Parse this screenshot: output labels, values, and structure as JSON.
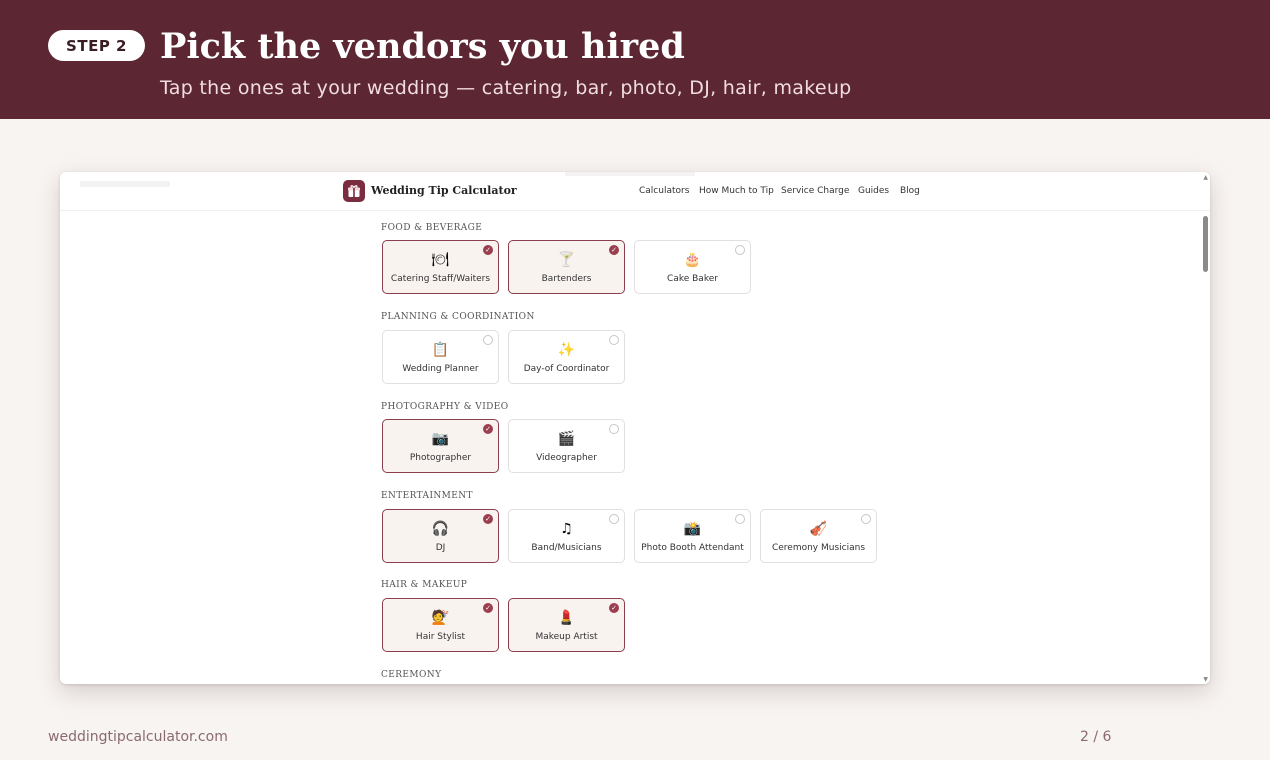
{
  "banner": {
    "step_label": "STEP 2",
    "title": "Pick the vendors you hired",
    "subtitle": "Tap the ones at your wedding — catering, bar, photo, DJ, hair, makeup",
    "background_color": "#5c2733"
  },
  "site": {
    "name": "Wedding Tip Calculator",
    "logo_icon": "gift-box-icon",
    "nav": [
      "Calculators",
      "How Much to Tip",
      "Service Charge",
      "Guides",
      "Blog"
    ],
    "accent_color": "#8b3e4d"
  },
  "sections": [
    {
      "heading": "FOOD & BEVERAGE",
      "vendors": [
        {
          "label": "Catering Staff/Waiters",
          "icon": "🍽",
          "icon_name": "plate-cutlery-icon",
          "selected": true
        },
        {
          "label": "Bartenders",
          "icon": "🍸",
          "icon_name": "cocktail-icon",
          "selected": true
        },
        {
          "label": "Cake Baker",
          "icon": "🎂",
          "icon_name": "cake-icon",
          "selected": false
        }
      ]
    },
    {
      "heading": "PLANNING & COORDINATION",
      "vendors": [
        {
          "label": "Wedding Planner",
          "icon": "📋",
          "icon_name": "clipboard-icon",
          "selected": false
        },
        {
          "label": "Day-of Coordinator",
          "icon": "✨",
          "icon_name": "sparkles-icon",
          "selected": false
        }
      ]
    },
    {
      "heading": "PHOTOGRAPHY & VIDEO",
      "vendors": [
        {
          "label": "Photographer",
          "icon": "📷",
          "icon_name": "camera-icon",
          "selected": true
        },
        {
          "label": "Videographer",
          "icon": "🎬",
          "icon_name": "clapperboard-icon",
          "selected": false
        }
      ]
    },
    {
      "heading": "ENTERTAINMENT",
      "vendors": [
        {
          "label": "DJ",
          "icon": "🎧",
          "icon_name": "headphones-icon",
          "selected": true
        },
        {
          "label": "Band/Musicians",
          "icon": "♫",
          "icon_name": "music-note-icon",
          "selected": false
        },
        {
          "label": "Photo Booth Attendant",
          "icon": "📸",
          "icon_name": "photo-booth-icon",
          "selected": false
        },
        {
          "label": "Ceremony Musicians",
          "icon": "🎻",
          "icon_name": "violin-icon",
          "selected": false
        }
      ]
    },
    {
      "heading": "HAIR & MAKEUP",
      "vendors": [
        {
          "label": "Hair Stylist",
          "icon": "💇",
          "icon_name": "hair-stylist-icon",
          "selected": true
        },
        {
          "label": "Makeup Artist",
          "icon": "💄",
          "icon_name": "lipstick-icon",
          "selected": true
        }
      ]
    },
    {
      "heading": "CEREMONY",
      "vendors": []
    }
  ],
  "footer": {
    "domain": "weddingtipcalculator.com",
    "page_indicator": "2 / 6"
  }
}
